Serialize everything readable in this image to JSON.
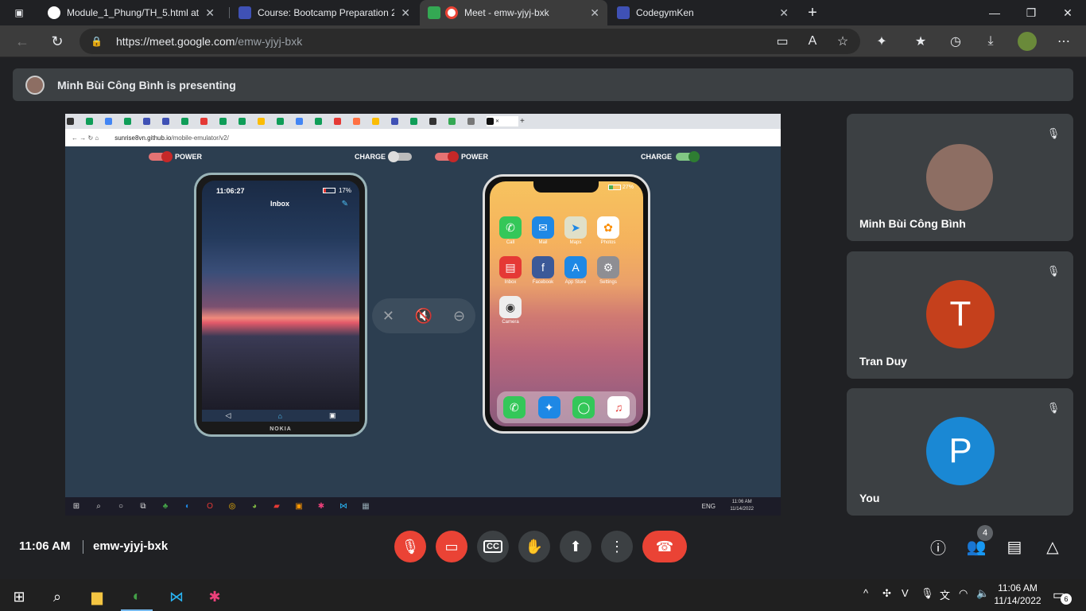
{
  "browser": {
    "tabs": [
      {
        "title": "Module_1_Phung/TH_5.html at m",
        "icon": "github-icon",
        "active": false
      },
      {
        "title": "Course: Bootcamp Preparation 2",
        "icon": "codegym-icon",
        "active": false
      },
      {
        "title": "Meet - emw-yjyj-bxk",
        "icon": "meet-icon",
        "active": true
      },
      {
        "title": "CodegymKen",
        "icon": "codegym-icon",
        "active": false
      }
    ],
    "new_tab": "+",
    "url_host": "https://meet.google.com",
    "url_path": "/emw-yjyj-bxk"
  },
  "meet": {
    "presenting_text": "Minh Bùi Công Bình is presenting",
    "meeting_code": "emw-yjyj-bxk",
    "time": "11:06 AM",
    "people_count": "4",
    "participants": [
      {
        "name": "Minh Bùi Công Bình",
        "initial": "",
        "color": "#8d6e63"
      },
      {
        "name": "Tran Duy",
        "initial": "T",
        "color": "#c5401c"
      },
      {
        "name": "You",
        "initial": "P",
        "color": "#1a88d4"
      }
    ]
  },
  "shared_screen": {
    "inner_url_host": "sunrise8vn.github.io",
    "inner_url_path": "/mobile-emulator/v2/",
    "power_label": "POWER",
    "charge_label": "CHARGE",
    "nokia": {
      "time": "11:06:27",
      "title": "Inbox",
      "battery": "17%",
      "brand": "NOKIA"
    },
    "iphone": {
      "battery": "27%",
      "apps": [
        "Call",
        "Mail",
        "Maps",
        "Photos",
        "Inbox",
        "Facebook",
        "App Store",
        "Settings",
        "Camera"
      ]
    },
    "inner_taskbar": {
      "lang": "ENG",
      "time": "11:06 AM",
      "date": "11/14/2022"
    }
  },
  "taskbar": {
    "time": "11:06 AM",
    "date": "11/14/2022",
    "notifications": "6"
  },
  "colors": {
    "danger": "#ea4335",
    "panel": "#3c4043",
    "background": "#202124"
  }
}
